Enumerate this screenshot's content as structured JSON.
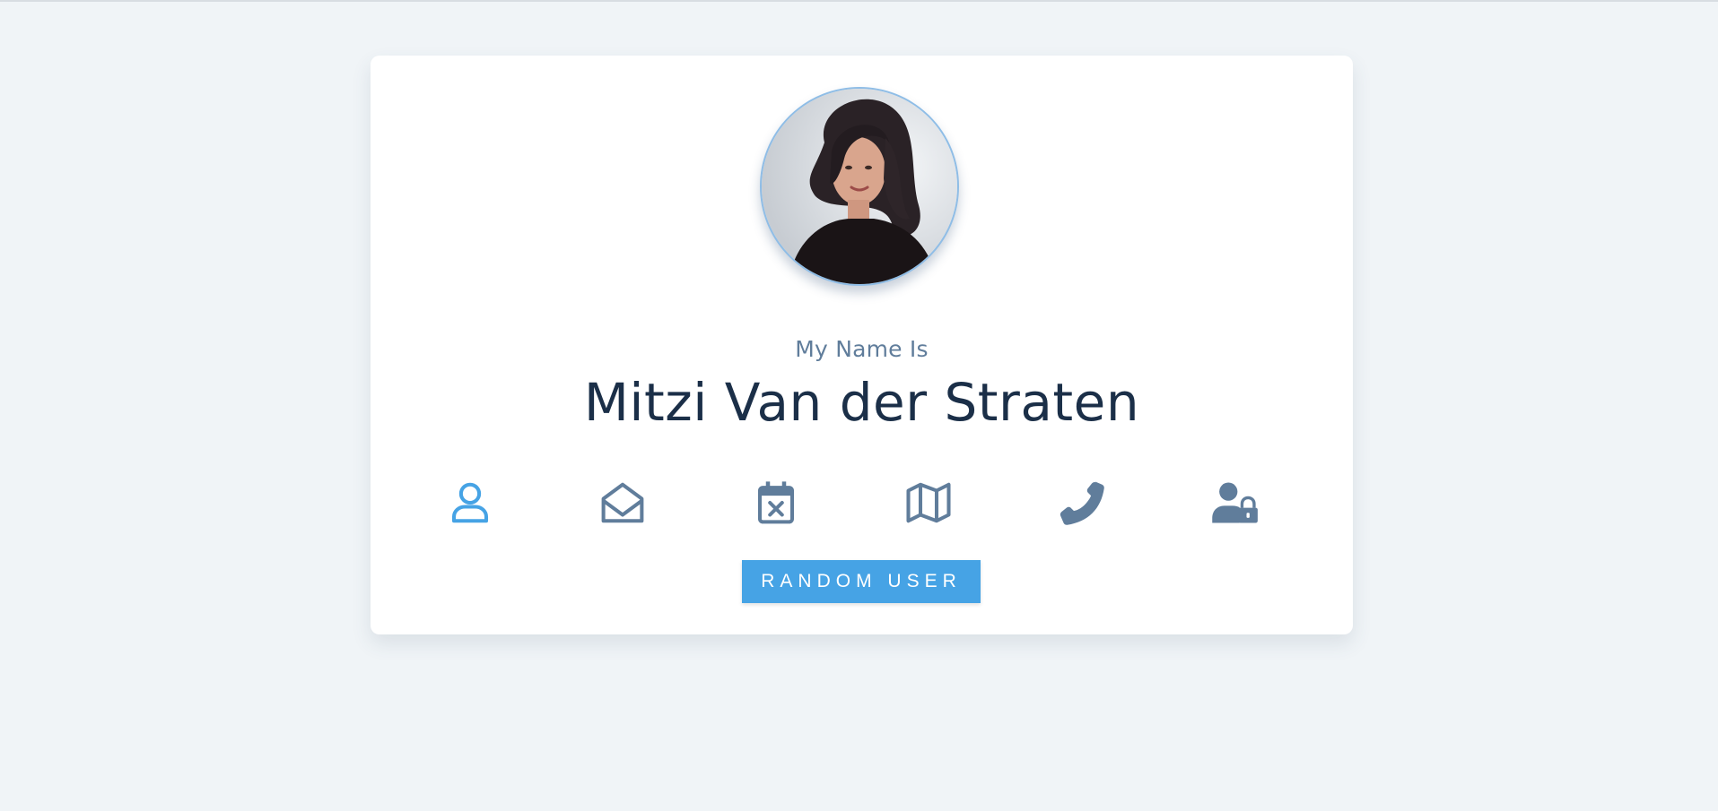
{
  "user": {
    "label": "My Name Is",
    "value": "Mitzi Van der Straten",
    "avatar_alt": "user-photo"
  },
  "icons": [
    {
      "name": "user-icon",
      "active": true
    },
    {
      "name": "envelope-open-icon",
      "active": false
    },
    {
      "name": "calendar-x-icon",
      "active": false
    },
    {
      "name": "map-icon",
      "active": false
    },
    {
      "name": "phone-icon",
      "active": false
    },
    {
      "name": "user-lock-icon",
      "active": false
    }
  ],
  "button": {
    "label": "RANDOM USER"
  },
  "colors": {
    "background": "#f0f4f7",
    "card": "#ffffff",
    "accent": "#46a3e5",
    "icon_inactive": "#607d9b",
    "label": "#607d9b",
    "value": "#1b2f48"
  }
}
